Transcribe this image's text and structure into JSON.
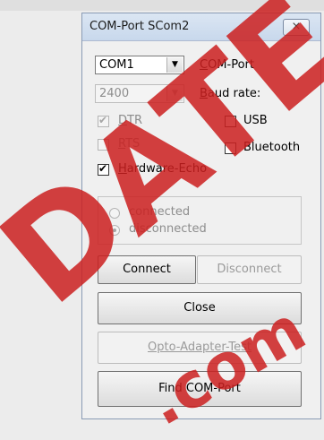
{
  "window": {
    "title": "COM-Port SCom2",
    "close_glyph": "⨯"
  },
  "port": {
    "value": "COM1",
    "label": "COM-Port",
    "label_underline": "C",
    "label_rest": "OM-Port"
  },
  "baud": {
    "value": "2400",
    "label_underline": "B",
    "label_rest": "aud rate:"
  },
  "checks": {
    "dtr": {
      "label_underline": "D",
      "label_rest": "TR",
      "checked": true,
      "disabled": true
    },
    "rts": {
      "label_underline": "R",
      "label_rest": "TS",
      "checked": false,
      "disabled": true
    },
    "echo": {
      "label_underline": "H",
      "label_rest": "ardware-Echo",
      "checked": true,
      "disabled": false
    },
    "usb": {
      "label": "USB",
      "checked": false
    },
    "bluetooth": {
      "label": "Bluetooth",
      "checked": false
    }
  },
  "status": {
    "connected": "connected",
    "disconnected": "disconnected",
    "selected": "disconnected"
  },
  "buttons": {
    "connect": "Connect",
    "disconnect": "Disconnect",
    "close": "Close",
    "opto_test": "Opto-Adapter-Test",
    "find_port": "Find COM-Port"
  },
  "watermark": {
    "word": "DATE",
    "domain": ".com"
  },
  "colors": {
    "watermark": "#cc2020",
    "title_bar": "#d3e0f0"
  }
}
